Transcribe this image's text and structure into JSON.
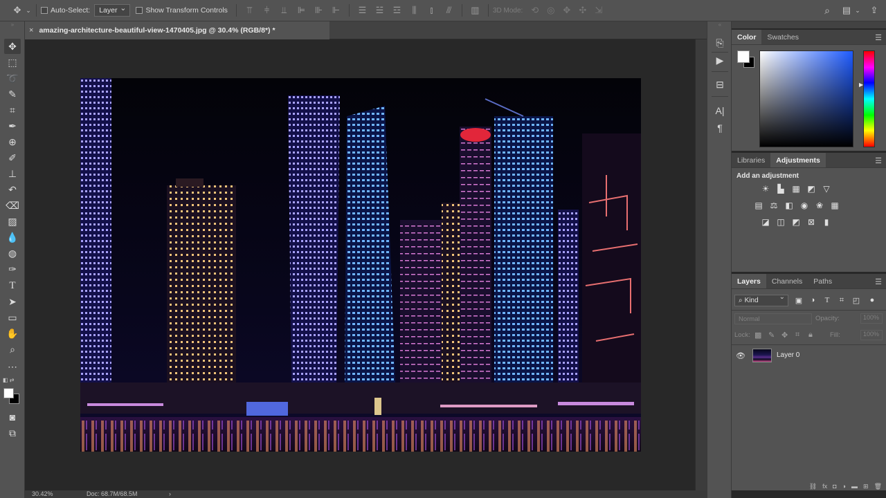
{
  "options_bar": {
    "auto_select_label": "Auto-Select:",
    "auto_select_value": "Layer",
    "transform_controls_label": "Show Transform Controls",
    "mode_3d_label": "3D Mode:"
  },
  "document": {
    "tab_title": "amazing-architecture-beautiful-view-1470405.jpg @ 30.4% (RGB/8*) *",
    "close_glyph": "×"
  },
  "status_bar": {
    "zoom": "30.42%",
    "doc_size": "Doc: 68.7M/68.5M",
    "arrow": "›"
  },
  "color_panel": {
    "tabs": [
      "Color",
      "Swatches"
    ],
    "foreground": "#ffffff",
    "background": "#000000"
  },
  "adjustments_panel": {
    "tabs": [
      "Libraries",
      "Adjustments"
    ],
    "title": "Add an adjustment"
  },
  "layers_panel": {
    "tabs": [
      "Layers",
      "Channels",
      "Paths"
    ],
    "filter_kind": "Kind",
    "blend_mode": "Normal",
    "opacity_label": "Opacity:",
    "opacity_value": "100%",
    "lock_label": "Lock:",
    "fill_label": "Fill:",
    "fill_value": "100%",
    "layers": [
      {
        "name": "Layer 0",
        "visible": true
      }
    ]
  }
}
